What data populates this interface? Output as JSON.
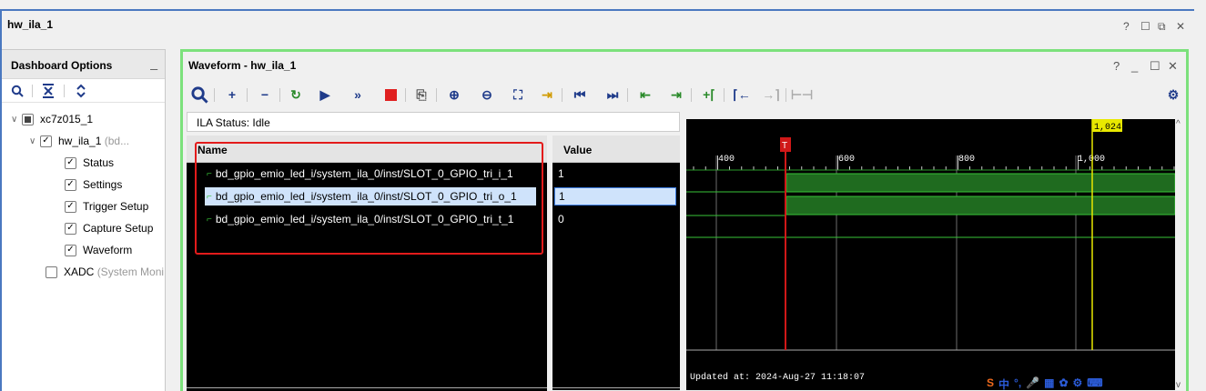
{
  "window": {
    "title": "hw_ila_1",
    "controls": [
      "?",
      "☐",
      "⧉",
      "✕"
    ]
  },
  "dashboard": {
    "title": "Dashboard Options",
    "minimize": "_",
    "tree": [
      {
        "label": "xc7z015_1",
        "suffix": "",
        "checked": "partial",
        "expanded": true
      },
      {
        "label": "hw_ila_1",
        "suffix": "(bd...",
        "checked": true,
        "expanded": true
      },
      {
        "label": "Status",
        "suffix": "",
        "checked": true
      },
      {
        "label": "Settings",
        "suffix": "",
        "checked": true
      },
      {
        "label": "Trigger Setup",
        "suffix": "",
        "checked": true
      },
      {
        "label": "Capture Setup",
        "suffix": "",
        "checked": true
      },
      {
        "label": "Waveform",
        "suffix": "",
        "checked": true
      },
      {
        "label": "XADC",
        "suffix": "(System Moni",
        "checked": false
      }
    ]
  },
  "waveform": {
    "title": "Waveform - hw_ila_1",
    "controls": [
      "?",
      "_",
      "☐",
      "✕"
    ],
    "status_label": "ILA Status:",
    "status_value": "Idle",
    "names_header": "Name",
    "values_header": "Value",
    "signals": [
      {
        "name": "bd_gpio_emio_led_i/system_ila_0/inst/SLOT_0_GPIO_tri_i_1",
        "value": "1",
        "selected": false
      },
      {
        "name": "bd_gpio_emio_led_i/system_ila_0/inst/SLOT_0_GPIO_tri_o_1",
        "value": "1",
        "selected": true
      },
      {
        "name": "bd_gpio_emio_led_i/system_ila_0/inst/SLOT_0_GPIO_tri_t_1",
        "value": "0",
        "selected": false
      }
    ],
    "ruler_labels": [
      "400",
      "600",
      "800",
      "1,000"
    ],
    "trigger_marker": "T",
    "cursor_label": "1,024",
    "updated_text": "Updated at: 2024-Aug-27 11:18:07"
  },
  "icons": {
    "search": "search-icon",
    "collapse": "collapse-all-icon",
    "expand": "expand-all-icon",
    "settings": "gear-icon",
    "run": "run-trigger-icon",
    "stop": "stop-icon"
  },
  "colors": {
    "accent_border": "#7ce17c",
    "highlight_box": "#e31b1b",
    "wave_green": "#1f6b1f",
    "trigger_marker": "#d01818",
    "cursor": "#e8e800",
    "window_border": "#4a78c0"
  },
  "tray": {
    "icons": [
      "S",
      "中",
      "°,",
      "🎤",
      "▦",
      "✿",
      "⚙",
      "⌨"
    ]
  }
}
